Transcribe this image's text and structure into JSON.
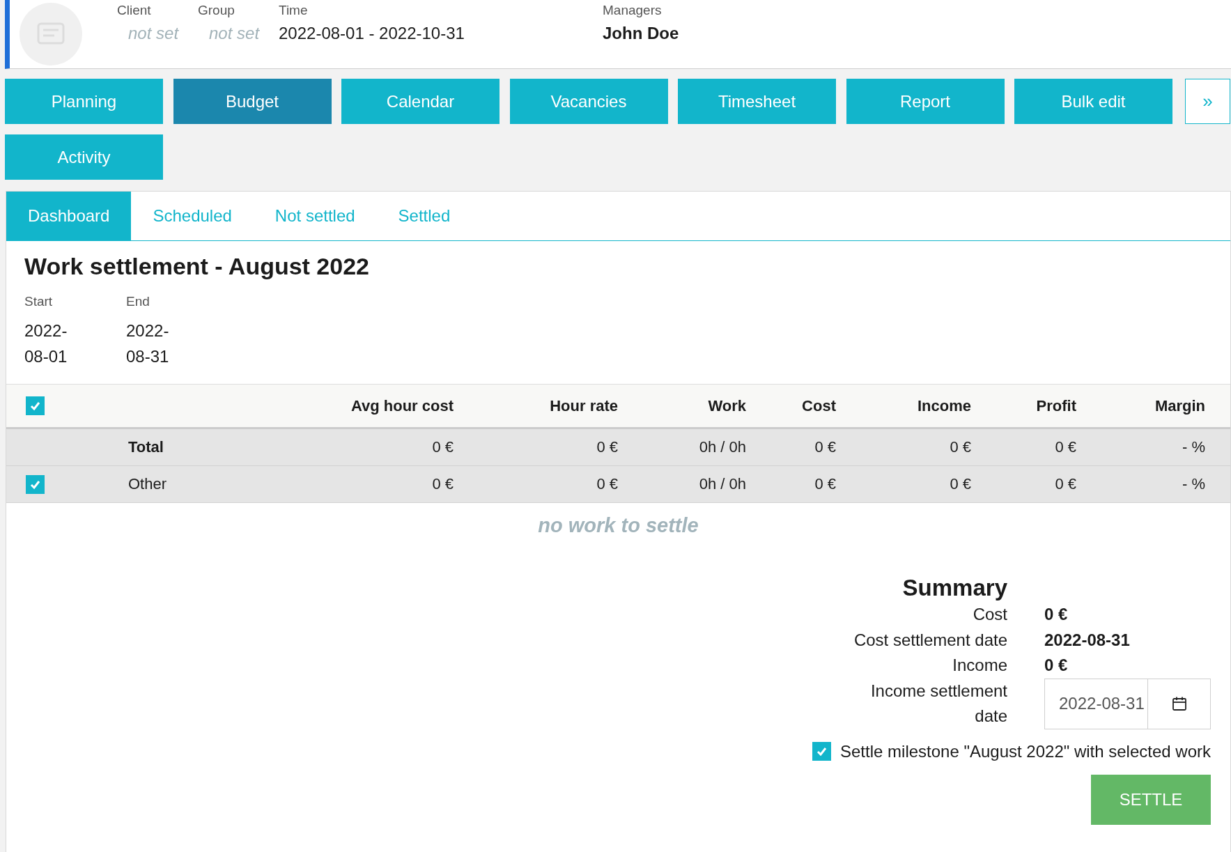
{
  "header": {
    "fields": [
      {
        "label": "Client",
        "value": "not set",
        "set": false
      },
      {
        "label": "Group",
        "value": "not set",
        "set": false
      },
      {
        "label": "Time",
        "value": "2022-08-01 - 2022-10-31",
        "set": true
      }
    ],
    "managers": {
      "label": "Managers",
      "value": "John Doe"
    }
  },
  "nav_buttons": [
    {
      "label": "Planning",
      "selected": false
    },
    {
      "label": "Budget",
      "selected": true
    },
    {
      "label": "Calendar",
      "selected": false
    },
    {
      "label": "Vacancies",
      "selected": false
    },
    {
      "label": "Timesheet",
      "selected": false
    },
    {
      "label": "Report",
      "selected": false
    },
    {
      "label": "Bulk edit",
      "selected": false
    },
    {
      "label": "Activity",
      "selected": false
    }
  ],
  "more_button": "»",
  "tabs": [
    {
      "label": "Dashboard",
      "selected": true
    },
    {
      "label": "Scheduled",
      "selected": false
    },
    {
      "label": "Not settled",
      "selected": false
    },
    {
      "label": "Settled",
      "selected": false
    }
  ],
  "title": "Work settlement - August 2022",
  "period": [
    {
      "label": "Start",
      "value": "2022-08-01"
    },
    {
      "label": "End",
      "value": "2022-08-31"
    }
  ],
  "table": {
    "select_all_checked": true,
    "columns": [
      "Avg hour cost",
      "Hour rate",
      "Work",
      "Cost",
      "Income",
      "Profit",
      "Margin"
    ],
    "total_row": {
      "name": "Total",
      "values": [
        "0 €",
        "0 €",
        "0h / 0h",
        "0 €",
        "0 €",
        "0 €",
        "- %"
      ]
    },
    "rows": [
      {
        "name": "Other",
        "checked": true,
        "values": [
          "0 €",
          "0 €",
          "0h / 0h",
          "0 €",
          "0 €",
          "0 €",
          "- %"
        ]
      }
    ],
    "empty_message": "no work to settle"
  },
  "summary": {
    "title": "Summary",
    "rows": [
      {
        "kind": "text",
        "label": "Cost",
        "value": "0 €"
      },
      {
        "kind": "text",
        "label": "Cost settlement date",
        "value": "2022-08-31"
      },
      {
        "kind": "text",
        "label": "Income",
        "value": "0 €"
      },
      {
        "kind": "date_input",
        "label": "Income settlement date",
        "value": "2022-08-31"
      }
    ],
    "milestone": {
      "label": "Settle milestone \"August 2022\" with selected work",
      "checked": true
    },
    "settle_button": "SETTLE"
  }
}
